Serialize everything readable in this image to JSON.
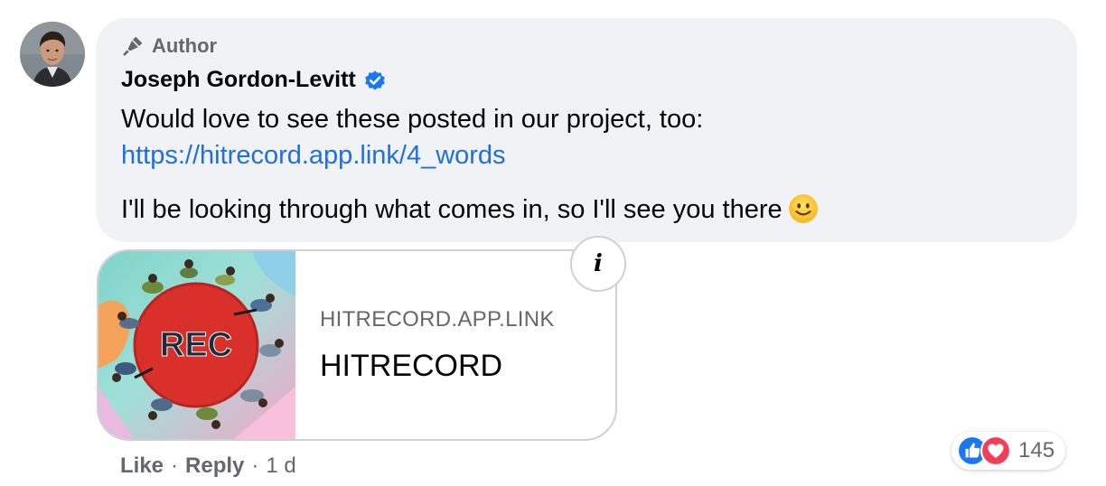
{
  "comment": {
    "badge": "Author",
    "author_name": "Joseph Gordon-Levitt",
    "text_line1": "Would love to see these posted in our project, too:",
    "link_url": "https://hitrecord.app.link/4_words",
    "text_line2": "I'll be looking through what comes in, so I'll see you there",
    "emoji": "smiling-face"
  },
  "link_preview": {
    "domain": "HITRECORD.APP.LINK",
    "title": "HITRECORD",
    "image_text": "REC",
    "info_label": "i"
  },
  "actions": {
    "like": "Like",
    "separator": "·",
    "reply": "Reply",
    "timestamp": "1 d"
  },
  "reactions": {
    "types": [
      "like",
      "love"
    ],
    "count": "145"
  },
  "colors": {
    "bubble": "#f0f2f5",
    "link": "#216fdb",
    "secondary_text": "#65676b",
    "verified": "#1877f2",
    "like_blue": "#1877f2",
    "love_red": "#f33e58"
  }
}
